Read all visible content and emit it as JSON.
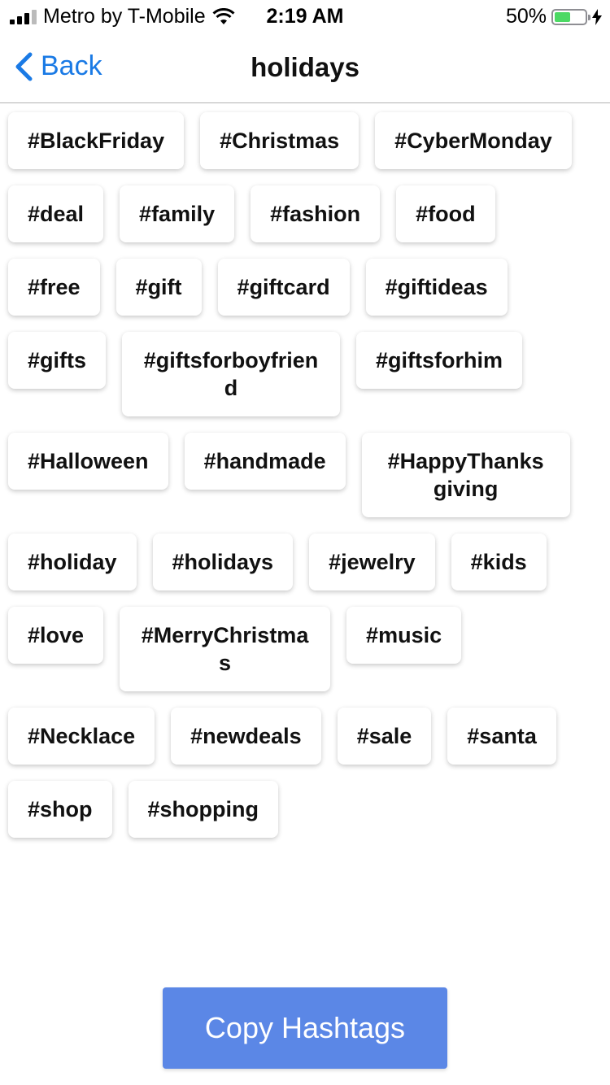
{
  "status_bar": {
    "carrier": "Metro by T-Mobile",
    "time": "2:19 AM",
    "battery_percent": "50%",
    "battery_level": 0.5,
    "icons": [
      "signal-icon",
      "wifi-icon",
      "battery-icon",
      "charging-bolt-icon"
    ]
  },
  "nav": {
    "back_label": "Back",
    "title": "holidays",
    "accent_color": "#1a7ae5"
  },
  "tags": [
    {
      "label": "#BlackFriday"
    },
    {
      "label": "#Christmas"
    },
    {
      "label": "#CyberMonday"
    },
    {
      "label": "#deal"
    },
    {
      "label": "#family"
    },
    {
      "label": "#fashion"
    },
    {
      "label": "#food"
    },
    {
      "label": "#free"
    },
    {
      "label": "#gift"
    },
    {
      "label": "#giftcard"
    },
    {
      "label": "#giftideas"
    },
    {
      "label": "#gifts"
    },
    {
      "label": "#giftsforboyfriend"
    },
    {
      "label": "#giftsforhim"
    },
    {
      "label": "#Halloween"
    },
    {
      "label": "#handmade"
    },
    {
      "label": "#HappyThanksgiving"
    },
    {
      "label": "#holiday"
    },
    {
      "label": "#holidays"
    },
    {
      "label": "#jewelry"
    },
    {
      "label": "#kids"
    },
    {
      "label": "#love"
    },
    {
      "label": "#MerryChristmas"
    },
    {
      "label": "#music"
    },
    {
      "label": "#Necklace"
    },
    {
      "label": "#newdeals"
    },
    {
      "label": "#sale"
    },
    {
      "label": "#santa"
    },
    {
      "label": "#shop"
    },
    {
      "label": "#shopping"
    }
  ],
  "copy_button": {
    "label": "Copy Hashtags",
    "color": "#5b87e6"
  }
}
